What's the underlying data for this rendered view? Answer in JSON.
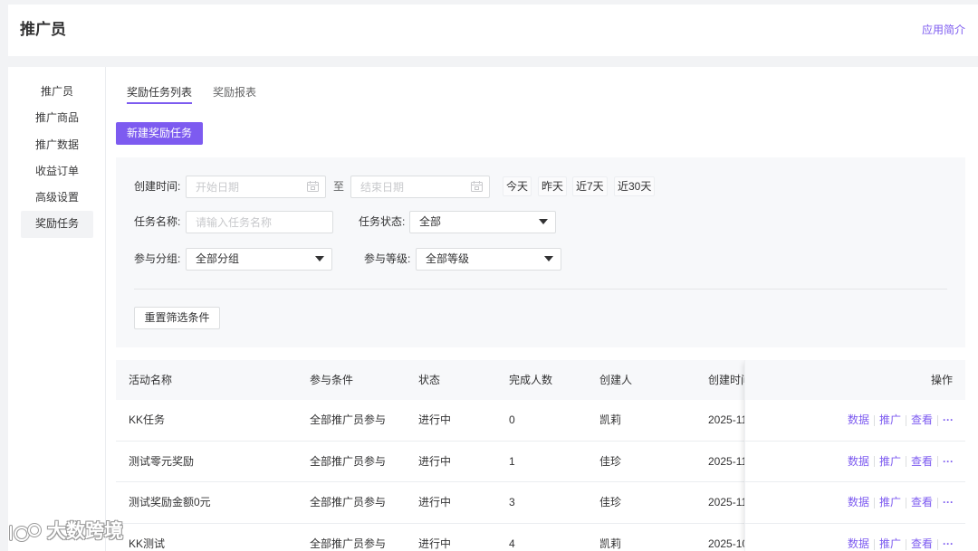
{
  "header": {
    "title": "推广员",
    "intro_link": "应用简介"
  },
  "sidebar": {
    "items": [
      {
        "label": "推广员",
        "selected": false
      },
      {
        "label": "推广商品",
        "selected": false
      },
      {
        "label": "推广数据",
        "selected": false
      },
      {
        "label": "收益订单",
        "selected": false
      },
      {
        "label": "高级设置",
        "selected": false
      },
      {
        "label": "奖励任务",
        "selected": true
      }
    ]
  },
  "tabs": [
    {
      "label": "奖励任务列表",
      "active": true
    },
    {
      "label": "奖励报表",
      "active": false
    }
  ],
  "toolbar": {
    "create_label": "新建奖励任务"
  },
  "filters": {
    "created_time": {
      "label": "创建时间:",
      "start_placeholder": "开始日期",
      "separator": "至",
      "end_placeholder": "结束日期",
      "quick_ranges": [
        "今天",
        "昨天",
        "近7天",
        "近30天"
      ]
    },
    "task_name": {
      "label": "任务名称:",
      "placeholder": "请输入任务名称"
    },
    "task_status": {
      "label": "任务状态:",
      "selected": "全部"
    },
    "group": {
      "label": "参与分组:",
      "selected": "全部分组"
    },
    "level": {
      "label": "参与等级:",
      "selected": "全部等级"
    },
    "reset_label": "重置筛选条件"
  },
  "table": {
    "columns": {
      "name": "活动名称",
      "condition": "参与条件",
      "status": "状态",
      "completed": "完成人数",
      "creator": "创建人",
      "created_at": "创建时间",
      "actions": "操作"
    },
    "rows": [
      {
        "name": "KK任务",
        "condition": "全部推广员参与",
        "status": "进行中",
        "completed": 0,
        "creator": "凯莉",
        "created_at": "2025-11"
      },
      {
        "name": "测试零元奖励",
        "condition": "全部推广员参与",
        "status": "进行中",
        "completed": 1,
        "creator": "佳珍",
        "created_at": "2025-11"
      },
      {
        "name": "测试奖励金额0元",
        "condition": "全部推广员参与",
        "status": "进行中",
        "completed": 3,
        "creator": "佳珍",
        "created_at": "2025-11"
      },
      {
        "name": "KK测试",
        "condition": "全部推广员参与",
        "status": "进行中",
        "completed": 4,
        "creator": "凯莉",
        "created_at": "2025-10"
      }
    ],
    "actions": [
      "数据",
      "推广",
      "查看"
    ],
    "more_label": "···"
  },
  "watermark": "大数跨境",
  "icons": {
    "date_picker": "calendar-icon",
    "select_caret": "caret-down-icon",
    "row_more": "more-icon"
  },
  "colors": {
    "accent": "#7d5bf0",
    "page_bg": "#f2f3f5",
    "panel_bg": "#f7f8fa",
    "text": "#323233",
    "placeholder": "#c8c9cc",
    "border": "#dcdee0"
  }
}
